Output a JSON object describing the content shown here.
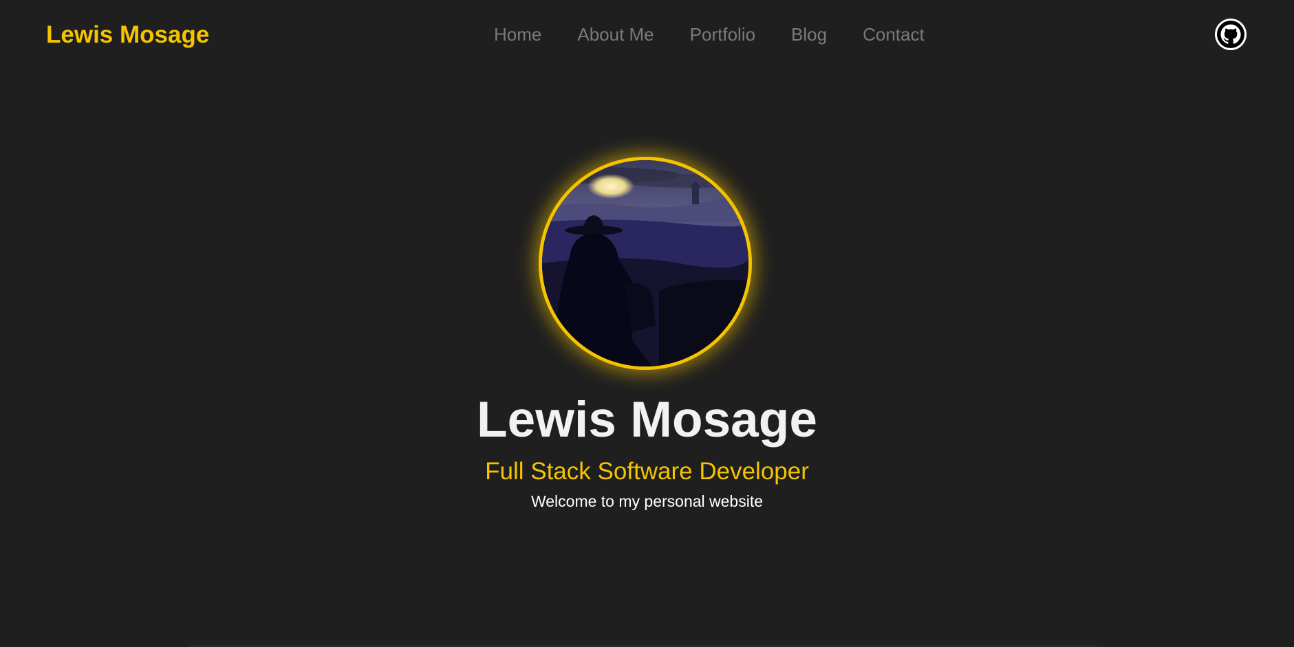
{
  "header": {
    "brand": "Lewis Mosage",
    "nav": [
      {
        "label": "Home"
      },
      {
        "label": "About Me"
      },
      {
        "label": "Portfolio"
      },
      {
        "label": "Blog"
      },
      {
        "label": "Contact"
      }
    ],
    "social_icon": "github-icon"
  },
  "hero": {
    "avatar_icon": "profile-avatar-image",
    "name": "Lewis Mosage",
    "role": "Full Stack Software Developer",
    "welcome": "Welcome to my personal website"
  },
  "colors": {
    "background": "#1f1f1f",
    "accent": "#f5c400",
    "nav_text": "#7a7a7a",
    "heading_text": "#f2f2f2"
  }
}
